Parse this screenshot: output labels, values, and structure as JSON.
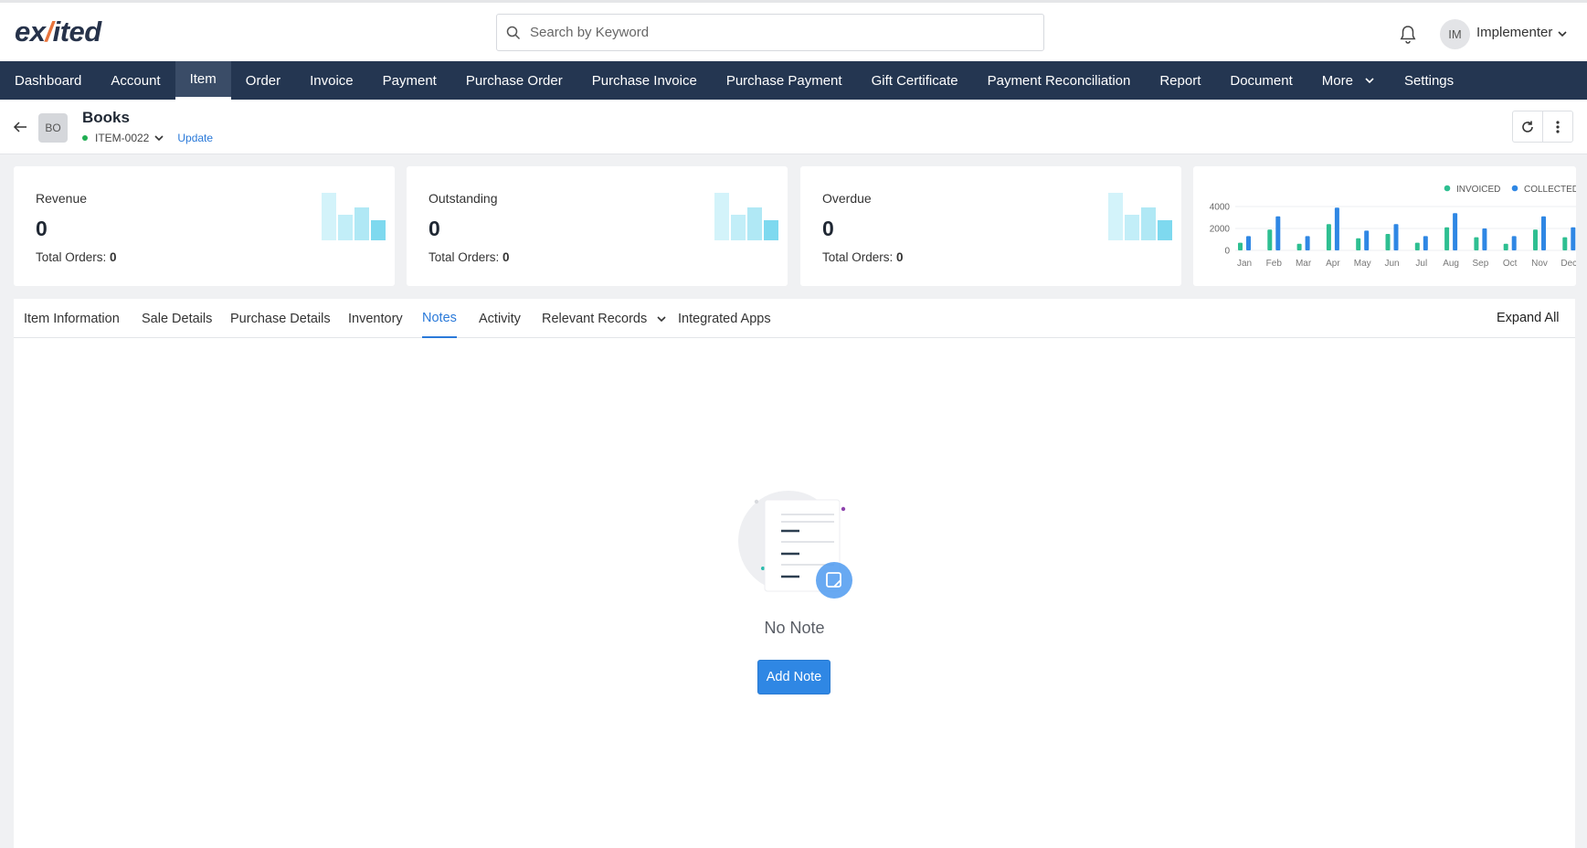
{
  "app": {
    "logo_text_1": "ex",
    "logo_text_2": "ited",
    "search_placeholder": "Search by Keyword",
    "user_initials": "IM",
    "user_name": "Implementer"
  },
  "nav": {
    "items": [
      "Dashboard",
      "Account",
      "Item",
      "Order",
      "Invoice",
      "Payment",
      "Purchase Order",
      "Purchase Invoice",
      "Purchase Payment",
      "Gift Certificate",
      "Payment Reconciliation",
      "Report",
      "Document",
      "More",
      "Settings"
    ],
    "active": "Item"
  },
  "record": {
    "avatar": "BO",
    "title": "Books",
    "code": "ITEM-0022",
    "update_label": "Update"
  },
  "cards": [
    {
      "label": "Revenue",
      "value": "0",
      "orders_label": "Total Orders:",
      "orders_value": "0"
    },
    {
      "label": "Outstanding",
      "value": "0",
      "orders_label": "Total Orders:",
      "orders_value": "0"
    },
    {
      "label": "Overdue",
      "value": "0",
      "orders_label": "Total Orders:",
      "orders_value": "0"
    }
  ],
  "chart_data": {
    "type": "bar",
    "categories": [
      "Jan",
      "Feb",
      "Mar",
      "Apr",
      "May",
      "Jun",
      "Jul",
      "Aug",
      "Sep",
      "Oct",
      "Nov",
      "Dec"
    ],
    "series": [
      {
        "name": "INVOICED",
        "color": "#2ebf91",
        "values": [
          700,
          1900,
          600,
          2400,
          1100,
          1500,
          700,
          2100,
          1200,
          600,
          1900,
          1200
        ]
      },
      {
        "name": "COLLECTED",
        "color": "#2f87e4",
        "values": [
          1300,
          3100,
          1300,
          3900,
          1800,
          2400,
          1300,
          3400,
          2000,
          1300,
          3100,
          2100
        ]
      }
    ],
    "yticks": [
      "4000",
      "2000",
      "0"
    ],
    "ylim": [
      0,
      4000
    ]
  },
  "tabs": {
    "items": [
      "Item Information",
      "Sale Details",
      "Purchase Details",
      "Inventory",
      "Notes",
      "Activity",
      "Relevant Records",
      "Integrated Apps"
    ],
    "active": "Notes",
    "expand_label": "Expand All"
  },
  "empty": {
    "text": "No Note",
    "button": "Add Note"
  },
  "colors": {
    "nav_bg": "#243651",
    "accent": "#2b7ad9",
    "invoiced": "#2ebf91",
    "collected": "#2f87e4"
  }
}
